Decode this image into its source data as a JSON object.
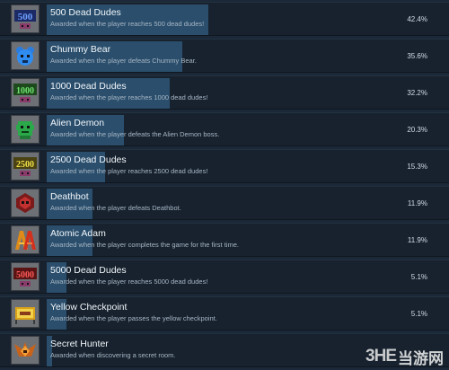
{
  "achievements": [
    {
      "title": "500 Dead Dudes",
      "description": "Awarded when the player reaches 500 dead dudes!",
      "percent_label": "42.4%",
      "percent": 42.4,
      "icon": "skull-500-icon"
    },
    {
      "title": "Chummy Bear",
      "description": "Awarded when the player defeats Chummy Bear.",
      "percent_label": "35.6%",
      "percent": 35.6,
      "icon": "bear-icon"
    },
    {
      "title": "1000 Dead Dudes",
      "description": "Awarded when the player reaches 1000 dead dudes!",
      "percent_label": "32.2%",
      "percent": 32.2,
      "icon": "skull-1000-icon"
    },
    {
      "title": "Alien Demon",
      "description": "Awarded when the player defeats the Alien Demon boss.",
      "percent_label": "20.3%",
      "percent": 20.3,
      "icon": "alien-demon-icon"
    },
    {
      "title": "2500 Dead Dudes",
      "description": "Awarded when the player reaches 2500 dead dudes!",
      "percent_label": "15.3%",
      "percent": 15.3,
      "icon": "skull-2500-icon"
    },
    {
      "title": "Deathbot",
      "description": "Awarded when the player defeats Deathbot.",
      "percent_label": "11.9%",
      "percent": 11.9,
      "icon": "deathbot-icon"
    },
    {
      "title": "Atomic Adam",
      "description": "Awarded when the player completes the game for the first time.",
      "percent_label": "11.9%",
      "percent": 11.9,
      "icon": "atomic-adam-icon"
    },
    {
      "title": "5000 Dead Dudes",
      "description": "Awarded when the player reaches 5000 dead dudes!",
      "percent_label": "5.1%",
      "percent": 5.1,
      "icon": "skull-5000-icon"
    },
    {
      "title": "Yellow Checkpoint",
      "description": "Awarded when the player passes the yellow checkpoint.",
      "percent_label": "5.1%",
      "percent": 5.1,
      "icon": "yellow-checkpoint-icon"
    },
    {
      "title": "Secret Hunter",
      "description": "Awarded when discovering a secret room.",
      "percent_label": "",
      "percent": 1.5,
      "icon": "secret-hunter-icon"
    }
  ],
  "watermark": {
    "logo": "3HE",
    "text": "当游网"
  },
  "colors": {
    "background": "#1b2838",
    "row": "#17222e",
    "progress_bar": "#2a4e6c",
    "title_text": "#f2f6fa",
    "description_text": "#a8b6c4"
  }
}
